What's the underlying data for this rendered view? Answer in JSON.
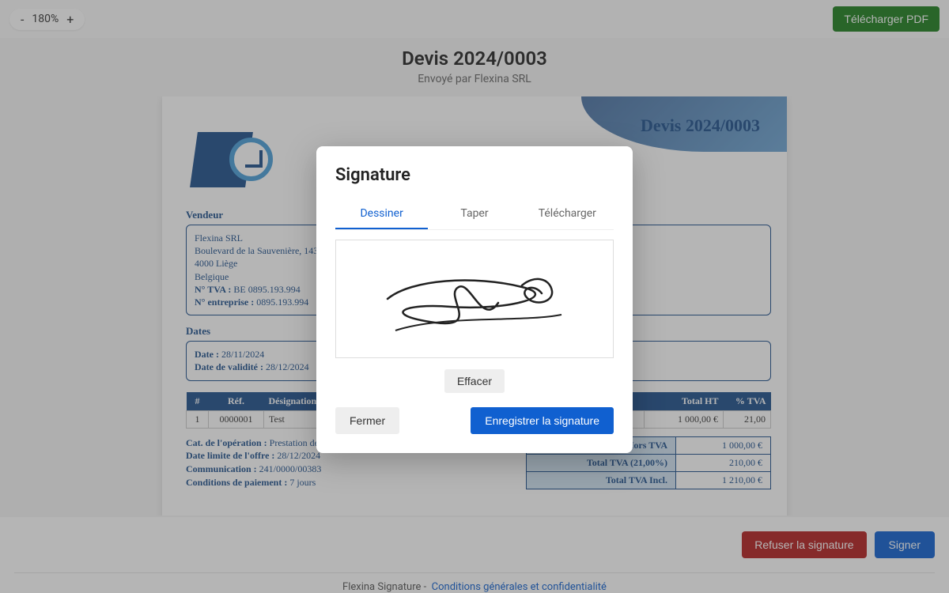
{
  "topbar": {
    "zoom_minus": "-",
    "zoom_value": "180%",
    "zoom_plus": "+",
    "download_label": "Télécharger PDF"
  },
  "header": {
    "title": "Devis 2024/0003",
    "subtitle": "Envoyé par Flexina SRL"
  },
  "doc": {
    "title": "Devis 2024/0003",
    "vendor_label": "Vendeur",
    "vendor": {
      "name": "Flexina SRL",
      "street": "Boulevard de la Sauvenière, 143",
      "city": "4000 Liège",
      "country": "Belgique",
      "vat_label": "N° TVA :",
      "vat_value": "BE 0895.193.994",
      "company_label": "N° entreprise :",
      "company_value": "0895.193.994"
    },
    "dates_label": "Dates",
    "dates": {
      "date_label": "Date :",
      "date_value": "28/11/2024",
      "valid_label": "Date de validité :",
      "valid_value": "28/12/2024"
    },
    "table": {
      "headers": {
        "num": "#",
        "ref": "Réf.",
        "desig": "Désignation",
        "total_ht": "Total HT",
        "tva": "% TVA"
      },
      "rows": [
        {
          "num": "1",
          "ref": "0000001",
          "desig": "Test",
          "total_ht": "1 000,00 €",
          "tva": "21,00"
        }
      ]
    },
    "notes": {
      "cat_label": "Cat. de l'opération :",
      "cat_value": "Prestation de services",
      "limit_label": "Date limite de l'offre :",
      "limit_value": "28/12/2024",
      "comm_label": "Communication :",
      "comm_value": "241/0000/00383",
      "cond_label": "Conditions de paiement :",
      "cond_value": "7 jours"
    },
    "totals": {
      "ht_label": "Total Hors TVA",
      "ht_value": "1 000,00 €",
      "tva_label": "Total TVA (21,00%)",
      "tva_value": "210,00 €",
      "incl_label": "Total TVA Incl.",
      "incl_value": "1 210,00 €"
    }
  },
  "bottombar": {
    "refuse_label": "Refuser la signature",
    "sign_label": "Signer",
    "footer_brand": "Flexina Signature -",
    "footer_link": "Conditions générales et confidentialité"
  },
  "modal": {
    "title": "Signature",
    "tabs": {
      "draw": "Dessiner",
      "type": "Taper",
      "upload": "Télécharger"
    },
    "clear_label": "Effacer",
    "close_label": "Fermer",
    "save_label": "Enregistrer la signature"
  }
}
